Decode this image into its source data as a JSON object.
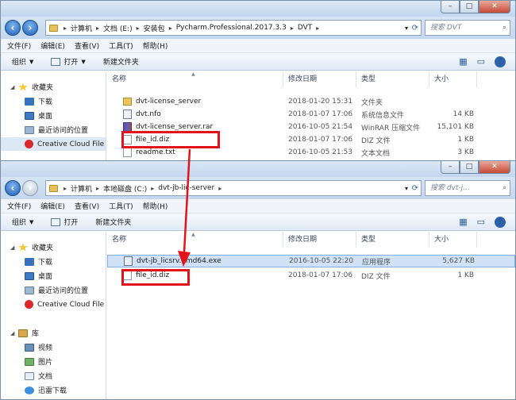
{
  "colors": {
    "annotation": "#e3131b",
    "address_bar": "#c4d7ee",
    "selection": "#cfe2f7"
  },
  "window_controls": {
    "min": "–",
    "max": "□",
    "close": "✕"
  },
  "window1": {
    "breadcrumb": [
      "计算机",
      "文档 (E:)",
      "安装包",
      "Pycharm.Professional.2017.3.3",
      "DVT"
    ],
    "search_placeholder": "搜索 DVT",
    "menu": [
      "文件(F)",
      "编辑(E)",
      "查看(V)",
      "工具(T)",
      "帮助(H)"
    ],
    "toolbar": {
      "organize": "组织",
      "open": "打开",
      "new_folder": "新建文件夹"
    },
    "sidebar": [
      {
        "label": "收藏夹",
        "icon": "star-icon"
      },
      {
        "label": "下载",
        "icon": "download-icon"
      },
      {
        "label": "桌面",
        "icon": "desktop-icon"
      },
      {
        "label": "最近访问的位置",
        "icon": "recent-places-icon"
      },
      {
        "label": "Creative Cloud File",
        "icon": "creative-cloud-icon"
      }
    ],
    "columns": {
      "name": "名称",
      "date": "修改日期",
      "type": "类型",
      "size": "大小"
    },
    "files": [
      {
        "name": "dvt-license_server",
        "date": "2018-01-20 15:31",
        "type": "文件夹",
        "size": "",
        "icon": "folder-icon"
      },
      {
        "name": "dvt.nfo",
        "date": "2018-01-07 17:06",
        "type": "系统信息文件",
        "size": "14 KB",
        "icon": "nfo-icon"
      },
      {
        "name": "dvt-license_server.rar",
        "date": "2016-10-05 21:54",
        "type": "WinRAR 压缩文件",
        "size": "15,101 KB",
        "icon": "rar-icon"
      },
      {
        "name": "file_id.diz",
        "date": "2018-01-07 17:06",
        "type": "DIZ 文件",
        "size": "1 KB",
        "icon": "file-icon"
      },
      {
        "name": "readme.txt",
        "date": "2016-10-05 21:53",
        "type": "文本文档",
        "size": "3 KB",
        "icon": "text-file-icon"
      }
    ]
  },
  "window2": {
    "breadcrumb": [
      "计算机",
      "本地磁盘 (C:)",
      "dvt-jb-lic-server"
    ],
    "search_placeholder": "搜索 dvt-j...",
    "menu": [
      "文件(F)",
      "编辑(E)",
      "查看(V)",
      "工具(T)",
      "帮助(H)"
    ],
    "toolbar": {
      "organize": "组织",
      "open": "打开",
      "new_folder": "新建文件夹"
    },
    "sidebar": [
      {
        "label": "收藏夹",
        "icon": "star-icon"
      },
      {
        "label": "下载",
        "icon": "download-icon"
      },
      {
        "label": "桌面",
        "icon": "desktop-icon"
      },
      {
        "label": "最近访问的位置",
        "icon": "recent-places-icon"
      },
      {
        "label": "Creative Cloud File",
        "icon": "creative-cloud-icon"
      },
      {
        "label": "库",
        "icon": "library-icon"
      },
      {
        "label": "视频",
        "icon": "video-icon"
      },
      {
        "label": "图片",
        "icon": "picture-icon"
      },
      {
        "label": "文档",
        "icon": "document-icon"
      },
      {
        "label": "迅雷下载",
        "icon": "xunlei-icon"
      }
    ],
    "columns": {
      "name": "名称",
      "date": "修改日期",
      "type": "类型",
      "size": "大小"
    },
    "files": [
      {
        "name": "dvt-jb_licsrv.amd64.exe",
        "date": "2016-10-05 22:20",
        "type": "应用程序",
        "size": "5,627 KB",
        "icon": "exe-icon"
      },
      {
        "name": "file_id.diz",
        "date": "2018-01-07 17:06",
        "type": "DIZ 文件",
        "size": "1 KB",
        "icon": "file-icon"
      }
    ]
  }
}
